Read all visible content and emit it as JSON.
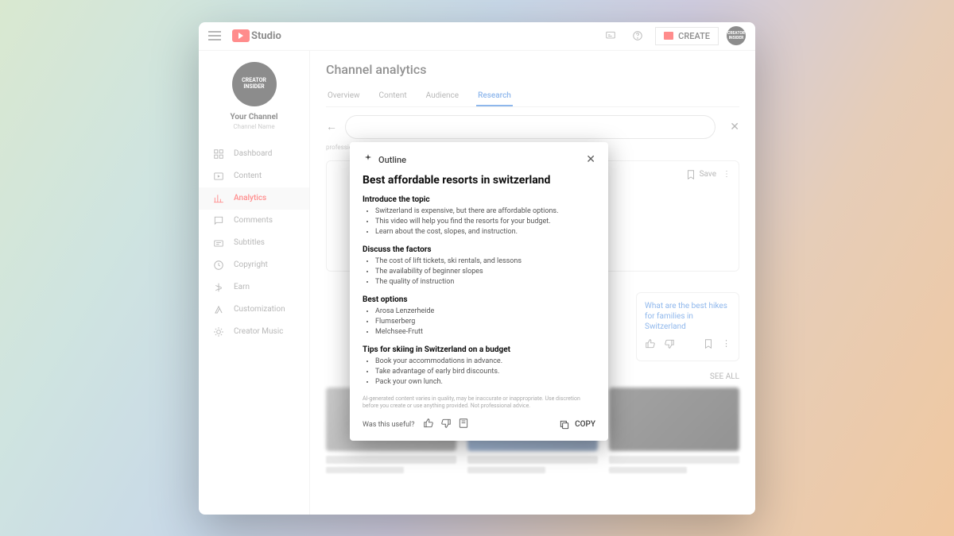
{
  "brand": "Studio",
  "header": {
    "create_label": "CREATE",
    "avatar_text": "CREATOR INSIDER"
  },
  "channel": {
    "badge_text": "CREATOR INSIDER",
    "title": "Your Channel",
    "subtitle": "Channel Name"
  },
  "sidebar": {
    "items": [
      {
        "label": "Dashboard"
      },
      {
        "label": "Content"
      },
      {
        "label": "Analytics"
      },
      {
        "label": "Comments"
      },
      {
        "label": "Subtitles"
      },
      {
        "label": "Copyright"
      },
      {
        "label": "Earn"
      },
      {
        "label": "Customization"
      },
      {
        "label": "Creator Music"
      }
    ]
  },
  "page": {
    "title": "Channel analytics",
    "tabs": [
      "Overview",
      "Content",
      "Audience",
      "Research"
    ],
    "disclaimer_tail": "professional advice",
    "card_save": "Save",
    "related_question": "What are the best hikes for families in Switzerland",
    "see_all": "SEE ALL"
  },
  "modal": {
    "chip": "Outline",
    "title": "Best affordable resorts in switzerland",
    "sections": [
      {
        "heading": "Introduce the topic",
        "items": [
          "Switzerland is expensive, but there are affordable options.",
          "This video will help you find the resorts for your budget.",
          "Learn about the cost, slopes, and instruction."
        ]
      },
      {
        "heading": "Discuss the factors",
        "items": [
          "The cost of lift tickets, ski rentals, and lessons",
          "The availability of beginner slopes",
          "The quality of instruction"
        ]
      },
      {
        "heading": "Best options",
        "items": [
          "Arosa Lenzerheide",
          "Flumserberg",
          "Melchsee-Frutt"
        ]
      },
      {
        "heading": "Tips for skiing in Switzerland on a budget",
        "items": [
          "Book your accommodations in advance.",
          "Take advantage of early bird discounts.",
          "Pack your own lunch."
        ]
      }
    ],
    "disclaimer": "AI-generated content varies in quality, may be inaccurate or inappropriate. Use discretion before you create or use anything provided. Not professional advice.",
    "useful_prompt": "Was this useful?",
    "copy_label": "COPY"
  }
}
